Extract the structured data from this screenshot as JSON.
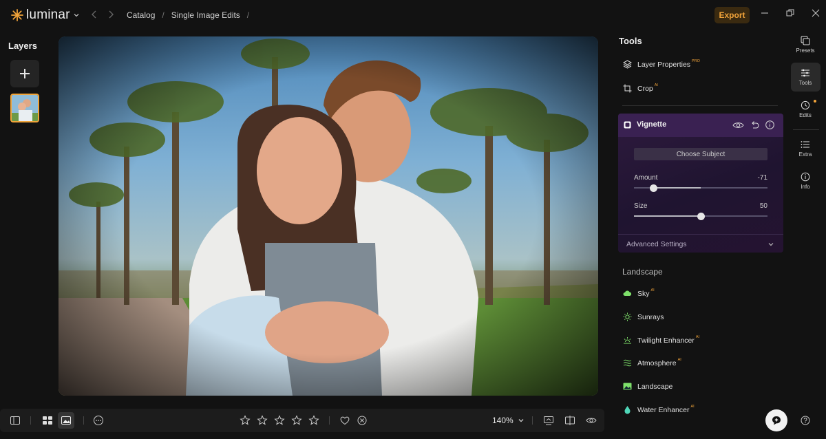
{
  "app": {
    "logo_text": "luminar",
    "breadcrumbs": [
      "Catalog",
      "Single Image Edits"
    ],
    "export_label": "Export",
    "accent_color": "#f2a43a"
  },
  "layers": {
    "title": "Layers"
  },
  "bottom_bar": {
    "zoom_label": "140%",
    "rating_stars": 0
  },
  "tools": {
    "title": "Tools",
    "items": [
      {
        "label": "Layer Properties",
        "badge": "PRO",
        "icon": "layers-icon"
      },
      {
        "label": "Crop",
        "badge": "AI",
        "icon": "crop-icon"
      }
    ],
    "vignette": {
      "title": "Vignette",
      "choose_subject_label": "Choose Subject",
      "amount_label": "Amount",
      "amount_value": "-71",
      "amount_fraction": 0.145,
      "size_label": "Size",
      "size_value": "50",
      "size_fraction": 0.5,
      "advanced_label": "Advanced Settings"
    },
    "landscape_section": {
      "title": "Landscape",
      "items": [
        {
          "label": "Sky",
          "badge": "AI",
          "icon": "cloud-icon",
          "color": "#7ee06a"
        },
        {
          "label": "Sunrays",
          "badge": "",
          "icon": "sun-icon",
          "color": "#7ee06a"
        },
        {
          "label": "Twilight Enhancer",
          "badge": "AI",
          "icon": "twilight-icon",
          "color": "#7ee06a"
        },
        {
          "label": "Atmosphere",
          "badge": "AI",
          "icon": "waves-icon",
          "color": "#7ee06a"
        },
        {
          "label": "Landscape",
          "badge": "",
          "icon": "image-icon",
          "color": "#7ee06a"
        },
        {
          "label": "Water Enhancer",
          "badge": "AI",
          "icon": "drop-icon",
          "color": "#4fd6b8"
        }
      ]
    }
  },
  "rail": {
    "items": [
      {
        "label": "Presets"
      },
      {
        "label": "Tools"
      },
      {
        "label": "Edits"
      },
      {
        "label": "Extra"
      },
      {
        "label": "Info"
      }
    ]
  }
}
